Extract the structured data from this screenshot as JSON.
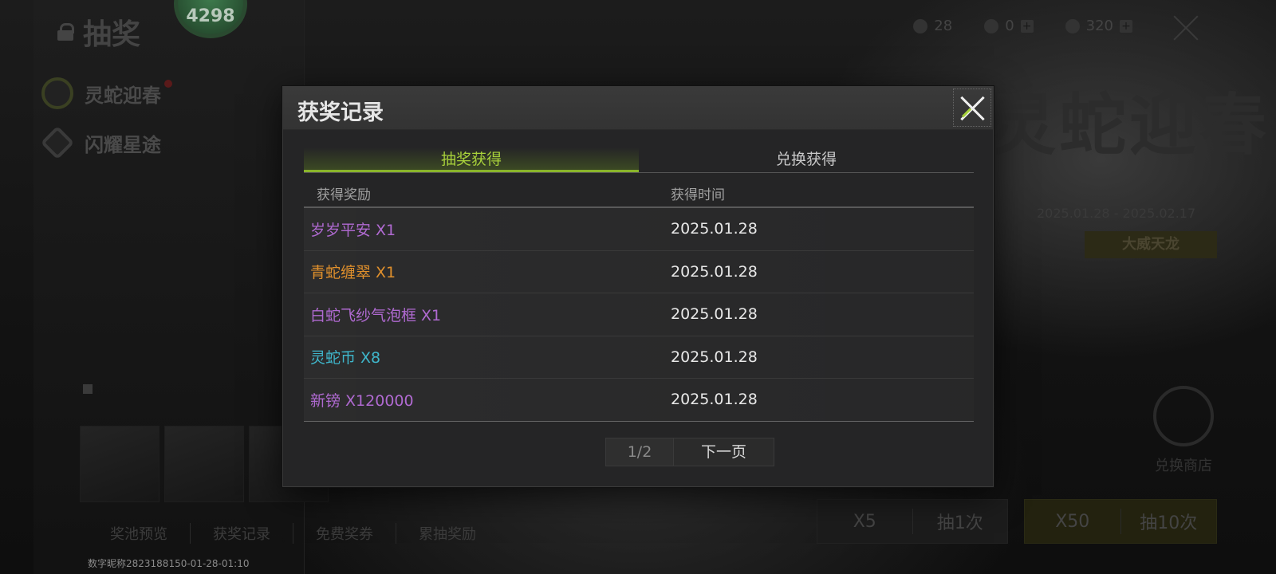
{
  "background": {
    "page_title": "抽奖",
    "avatar_badge": "4298",
    "side_nav": [
      {
        "label": "灵蛇迎春"
      },
      {
        "label": "闪耀星途"
      }
    ],
    "currency": [
      {
        "icon": "coin-icon",
        "value": "28"
      },
      {
        "icon": "feather-icon",
        "value": "0"
      },
      {
        "icon": "triangle-gem-icon",
        "value": "320"
      }
    ],
    "event_title": "灵蛇迎春",
    "event_date": "2025.01.28 - 2025.02.17",
    "event_tag": "大威天龙",
    "exchange_shop_label": "兑换商店",
    "draw_one": {
      "count": "X5",
      "label": "抽1次"
    },
    "draw_ten": {
      "count": "X50",
      "label": "抽10次"
    },
    "bottom_tabs": [
      "奖池预览",
      "获奖记录",
      "免费奖券",
      "累抽奖励"
    ],
    "footer_id": "数字昵称2823188150-01-28-01:10"
  },
  "modal": {
    "title": "获奖记录",
    "tabs": [
      {
        "label": "抽奖获得",
        "active": true
      },
      {
        "label": "兑换获得",
        "active": false
      }
    ],
    "columns": {
      "reward": "获得奖励",
      "time": "获得时间"
    },
    "rows": [
      {
        "reward": "岁岁平安 X1",
        "time": "2025.01.28",
        "color": "#b06ad1"
      },
      {
        "reward": "青蛇缠翠 X1",
        "time": "2025.01.28",
        "color": "#e0902c"
      },
      {
        "reward": "白蛇飞纱气泡框 X1",
        "time": "2025.01.28",
        "color": "#b06ad1"
      },
      {
        "reward": "灵蛇币 X8",
        "time": "2025.01.28",
        "color": "#3fb7cc"
      },
      {
        "reward": "新镑 X120000",
        "time": "2025.01.28",
        "color": "#b06ad1"
      }
    ],
    "pager": {
      "current": "1/2",
      "next_label": "下一页"
    }
  },
  "colors": {
    "accent_green": "#a8d13b",
    "rarity_purple": "#b06ad1",
    "rarity_orange": "#e0902c",
    "rarity_cyan": "#3fb7cc"
  }
}
